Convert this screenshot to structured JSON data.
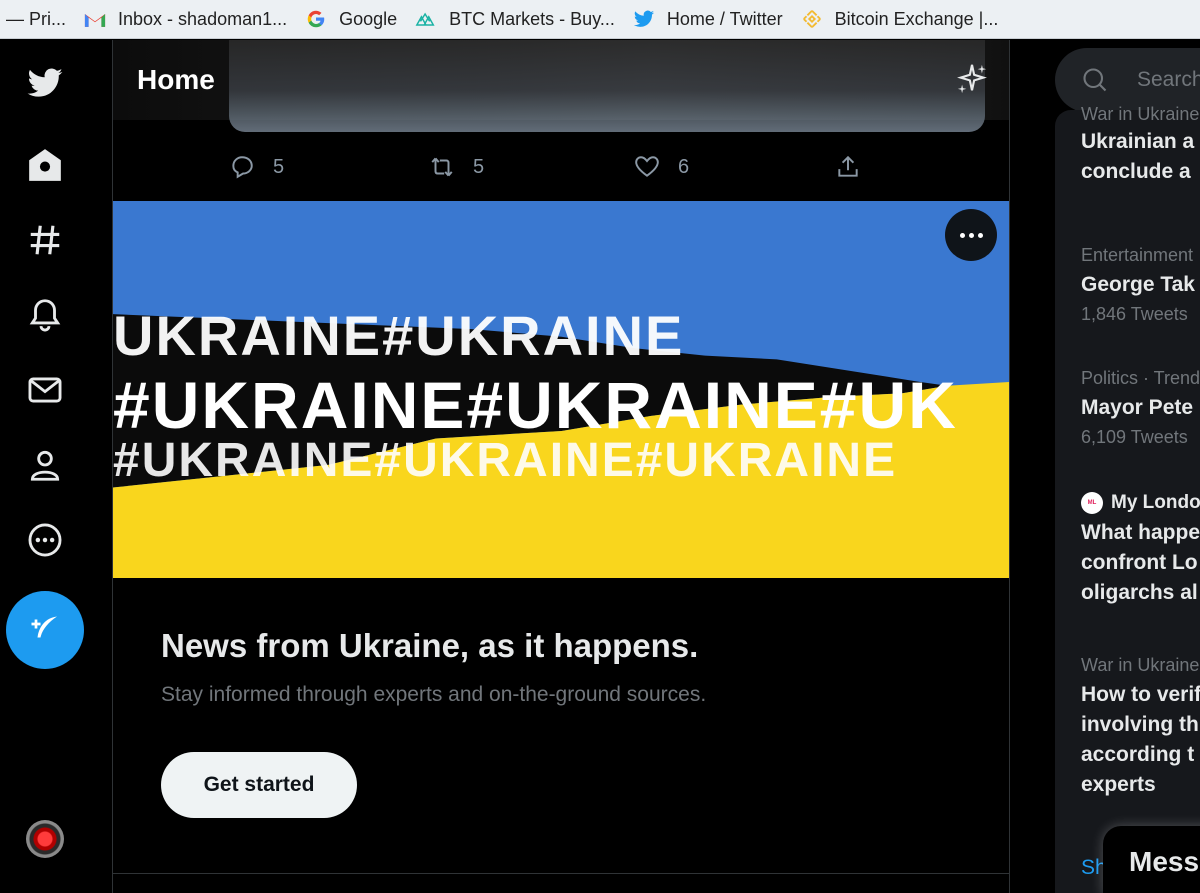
{
  "bookmarks": [
    {
      "label": "— Pri...",
      "icon": ""
    },
    {
      "label": "Inbox - shadoman1...",
      "icon": "gmail-icon"
    },
    {
      "label": "Google",
      "icon": "google-icon"
    },
    {
      "label": "BTC Markets - Buy...",
      "icon": "btc-markets-icon"
    },
    {
      "label": "Home / Twitter",
      "icon": "twitter-icon"
    },
    {
      "label": "Bitcoin Exchange |...",
      "icon": "binance-icon"
    }
  ],
  "header": {
    "title": "Home"
  },
  "tweet_actions": {
    "replies": "5",
    "retweets": "5",
    "likes": "6"
  },
  "banner": {
    "line1": "UKRAINE#UKRAINE",
    "line2": "#UKRAINE#UKRAINE#UK",
    "line3": "#UKRAINE#UKRAINE#UKRAINE"
  },
  "promo": {
    "title": "News from Ukraine, as it happens.",
    "subtitle": "Stay informed through experts and on-the-ground sources.",
    "cta": "Get started"
  },
  "search": {
    "placeholder": "Search"
  },
  "trends": [
    {
      "category": "War in Ukraine",
      "title_lines": [
        "Ukrainian a",
        "conclude a"
      ]
    },
    {
      "category": "Entertainment",
      "title_lines": [
        "George Tak"
      ],
      "count": "1,846 Tweets"
    },
    {
      "category": "Politics · Trend",
      "title_lines": [
        "Mayor Pete"
      ],
      "count": "6,109 Tweets"
    },
    {
      "source": "My London",
      "title_lines": [
        "What happe",
        "confront Lo",
        "oligarchs al"
      ]
    },
    {
      "category": "War in Ukraine",
      "title_lines": [
        "How to verif",
        "involving th",
        "according t",
        "experts"
      ]
    }
  ],
  "show_more": "Sh",
  "messages_label": "Mess",
  "colors": {
    "accent": "#1d9bf0",
    "flag_blue": "#3a78d0",
    "flag_yellow": "#f9d61d"
  }
}
